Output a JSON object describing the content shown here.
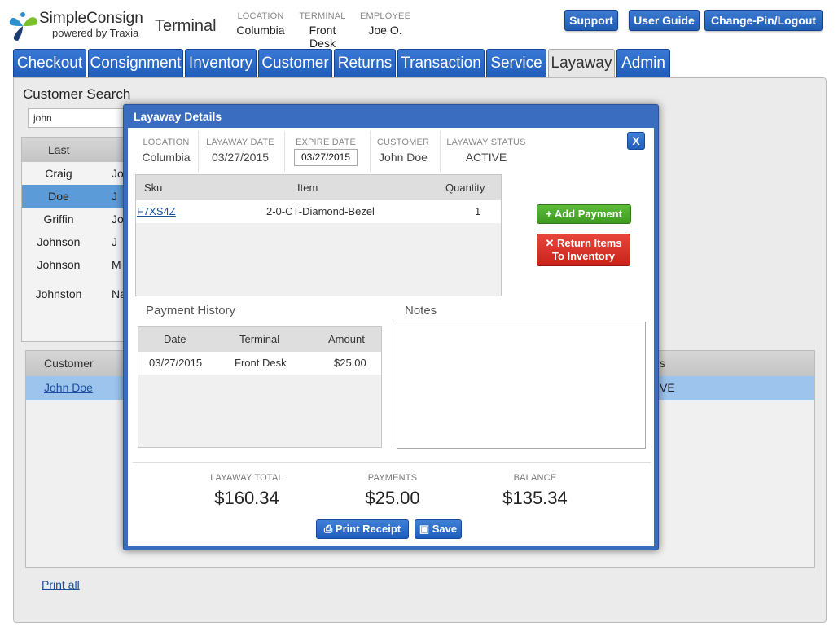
{
  "brand": {
    "name": "SimpleConsign",
    "sub": "powered by Traxia"
  },
  "header": {
    "title": "Terminal",
    "location_label": "LOCATION",
    "location": "Columbia",
    "terminal_label": "TERMINAL",
    "terminal": "Front Desk",
    "employee_label": "EMPLOYEE",
    "employee": "Joe O.",
    "support": "Support",
    "user_guide": "User Guide",
    "change_pin": "Change-Pin/Logout"
  },
  "tabs": [
    "Checkout",
    "Consignment",
    "Inventory",
    "Customer",
    "Returns",
    "Transaction",
    "Service",
    "Layaway",
    "Admin"
  ],
  "active_tab": "Layaway",
  "customer_search": {
    "title": "Customer Search",
    "query": "john",
    "header_last": "Last",
    "rows": [
      {
        "last": "Craig",
        "first": "Jo"
      },
      {
        "last": "Doe",
        "first": "J"
      },
      {
        "last": "Griffin",
        "first": "Jo"
      },
      {
        "last": "Johnson",
        "first": "J"
      },
      {
        "last": "Johnson",
        "first": "M"
      },
      {
        "last": "Johnston",
        "first": "Na"
      }
    ]
  },
  "layaway_list": {
    "header_customer": "Customer",
    "header_status_partial": "s",
    "row_customer": "John Doe",
    "row_status_partial": "VE"
  },
  "print_all": "Print all",
  "modal": {
    "title": "Layaway Details",
    "close": "X",
    "location_label": "LOCATION",
    "location": "Columbia",
    "layaway_date_label": "LAYAWAY DATE",
    "layaway_date": "03/27/2015",
    "expire_date_label": "EXPIRE DATE",
    "expire_date": "03/27/2015",
    "customer_label": "CUSTOMER",
    "customer": "John Doe",
    "status_label": "LAYAWAY STATUS",
    "status": "ACTIVE",
    "items": {
      "headers": {
        "sku": "Sku",
        "item": "Item",
        "quantity": "Quantity"
      },
      "rows": [
        {
          "sku": "F7XS4Z",
          "item": "2-0-CT-Diamond-Bezel",
          "quantity": "1"
        }
      ]
    },
    "add_payment": "Add Payment",
    "return_items_1": "Return Items",
    "return_items_2": "To Inventory",
    "payment_history": {
      "title": "Payment History",
      "headers": {
        "date": "Date",
        "terminal": "Terminal",
        "amount": "Amount"
      },
      "rows": [
        {
          "date": "03/27/2015",
          "terminal": "Front Desk",
          "amount": "$25.00"
        }
      ]
    },
    "notes_title": "Notes",
    "notes": "",
    "totals": {
      "total_label": "LAYAWAY TOTAL",
      "total": "$160.34",
      "payments_label": "PAYMENTS",
      "payments": "$25.00",
      "balance_label": "BALANCE",
      "balance": "$135.34"
    },
    "print_receipt": "Print Receipt",
    "save": "Save"
  }
}
